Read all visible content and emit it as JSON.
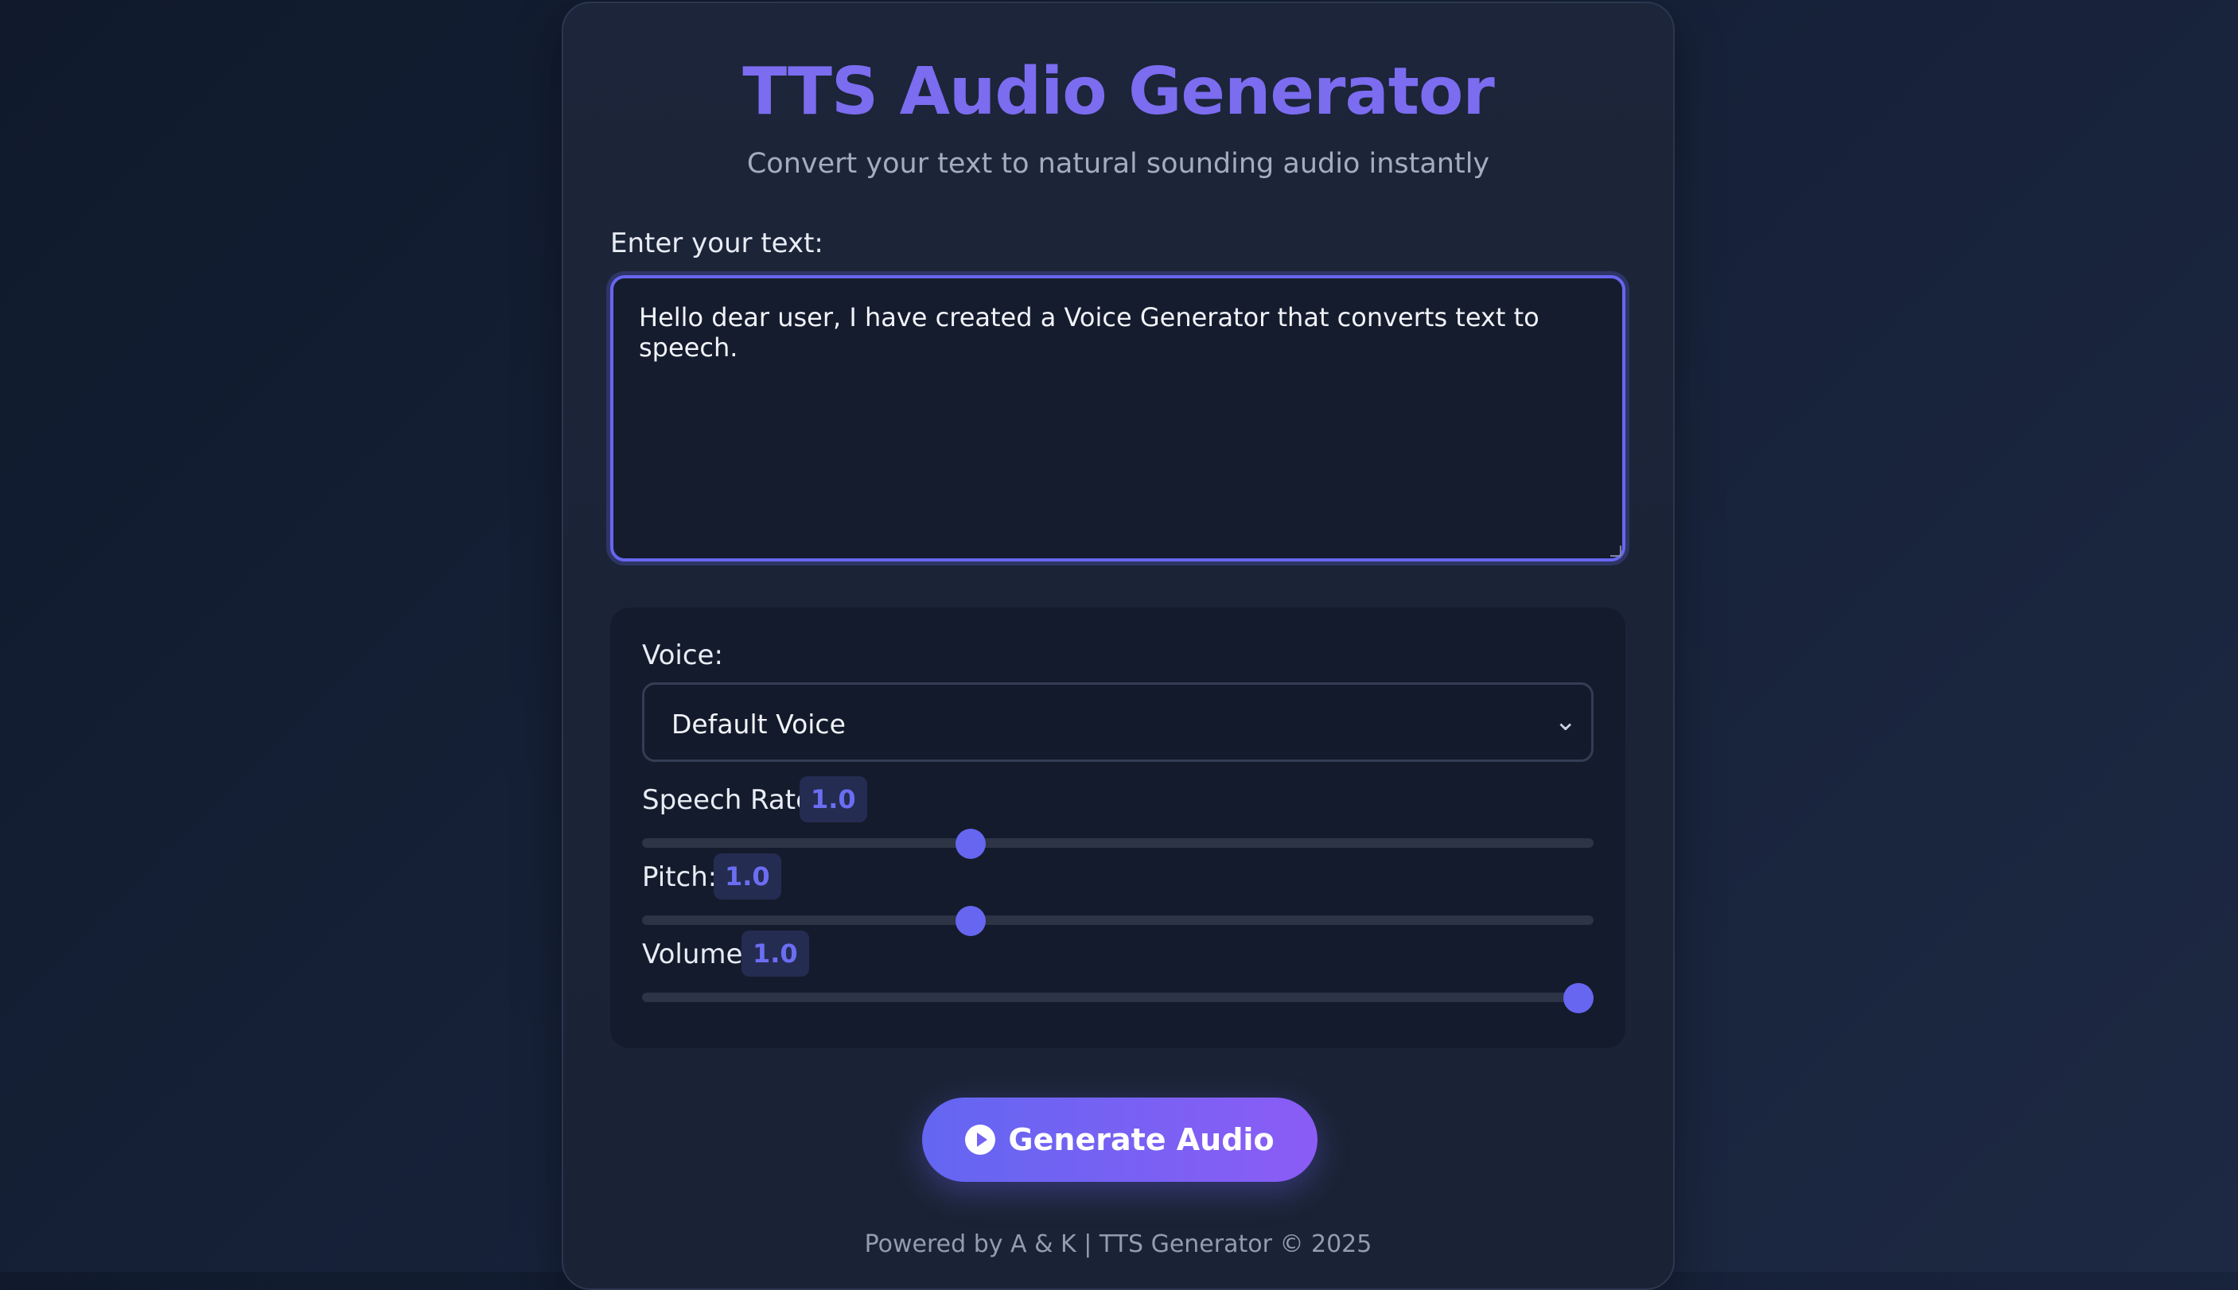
{
  "header": {
    "title": "TTS Audio Generator",
    "subtitle": "Convert your text to natural sounding audio instantly"
  },
  "text_input": {
    "label": "Enter your text:",
    "value": "Hello dear user, I have created a Voice Generator that converts text to speech."
  },
  "settings": {
    "voice": {
      "label": "Voice:",
      "selected": "Default Voice",
      "chevron_icon": "chevron-down-icon"
    },
    "speech_rate": {
      "label": "Speech Rate:",
      "value_text": "1.0",
      "slider_fraction": 0.34
    },
    "pitch": {
      "label": "Pitch:",
      "value_text": "1.0",
      "slider_fraction": 0.34
    },
    "volume": {
      "label": "Volume:",
      "value_text": "1.0",
      "slider_fraction": 1.0
    }
  },
  "action": {
    "button_label": "Generate Audio",
    "icon": "play-circle-icon"
  },
  "footer": {
    "text": "Powered by A & K | TTS Generator © 2025"
  },
  "colors": {
    "accent": "#6766f0",
    "title": "#7b6cf0",
    "button_gradient_start": "#6366f1",
    "button_gradient_end": "#8b5cf6"
  }
}
